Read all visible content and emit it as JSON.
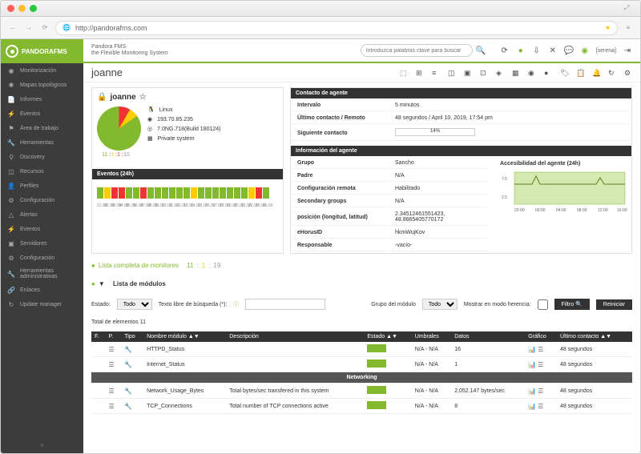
{
  "browser": {
    "url": "http://pandorafms.com"
  },
  "brand": {
    "name": "PANDORAFMS",
    "title": "Pandora FMS",
    "subtitle": "the Flexible Monitoring System"
  },
  "search": {
    "placeholder": "Introduzca palabras clave para buscar"
  },
  "user": {
    "name": "[serena]"
  },
  "sidebar": {
    "items": [
      {
        "icon": "◉",
        "label": "Monitorización"
      },
      {
        "icon": "✱",
        "label": "Mapas topológicos"
      },
      {
        "icon": "📄",
        "label": "Informes"
      },
      {
        "icon": "⚡",
        "label": "Eventos"
      },
      {
        "icon": "⚑",
        "label": "Área de trabajo"
      },
      {
        "icon": "🔧",
        "label": "Herramientas"
      },
      {
        "icon": "⚲",
        "label": "Discovery"
      },
      {
        "icon": "◫",
        "label": "Recursos"
      },
      {
        "icon": "👤",
        "label": "Perfiles"
      },
      {
        "icon": "⚙",
        "label": "Configuración"
      },
      {
        "icon": "△",
        "label": "Alertas"
      },
      {
        "icon": "⚡",
        "label": "Eventos"
      },
      {
        "icon": "▣",
        "label": "Servidores"
      },
      {
        "icon": "⚙",
        "label": "Configuración"
      },
      {
        "icon": "🔧",
        "label": "Herramientas administrativas"
      },
      {
        "icon": "🔗",
        "label": "Enlaces"
      },
      {
        "icon": "↻",
        "label": "Update manager"
      }
    ]
  },
  "page_title": "joanne",
  "agent": {
    "name": "joanne",
    "os": "Linux",
    "ip": "193.70.85.235",
    "version": "7.0NG.718(Build 180124)",
    "system": "Private system",
    "status_counts": "11 : 1 : 1 : 10"
  },
  "contact": {
    "title": "Contacto de agente",
    "rows": [
      {
        "k": "Intervalo",
        "v": "5 minutos"
      },
      {
        "k": "Último contacto / Remoto",
        "v": "48 segundos / April 10, 2019, 17:54 pm"
      },
      {
        "k": "Siguiente contacto",
        "v": "14%"
      }
    ]
  },
  "info": {
    "title": "Información del agente",
    "rows": [
      {
        "k": "Grupo",
        "v": "Sancho"
      },
      {
        "k": "Padre",
        "v": "N/A"
      },
      {
        "k": "Configuración remota",
        "v": "Habilitado"
      },
      {
        "k": "Secondary groups",
        "v": "N/A"
      },
      {
        "k": "posición (longitud, latitud)",
        "v": "2.34512461551423, 48.8665405770172"
      },
      {
        "k": "eHorusID",
        "v": "hkmWujKov"
      },
      {
        "k": "Responsable",
        "v": "-vacío-"
      }
    ]
  },
  "access": {
    "title": "Accesibilidad del agente (24h)",
    "ylabels": [
      "7.5",
      "2.5"
    ],
    "xlabels": [
      "20:00",
      "00:00",
      "04:00",
      "08:00",
      "12:00",
      "16:00"
    ]
  },
  "events": {
    "title": "Eventos (24h)",
    "bars": [
      "g",
      "y",
      "r",
      "r",
      "g",
      "g",
      "r",
      "g",
      "g",
      "g",
      "g",
      "g",
      "g",
      "y",
      "g",
      "g",
      "g",
      "g",
      "g",
      "g",
      "g",
      "y",
      "r",
      "g"
    ],
    "axis": [
      "01.00",
      "02.00",
      "03.00",
      "04.00",
      "05.00",
      "06.00",
      "07.00",
      "08.00",
      "09.00",
      "10.00",
      "11.00",
      "12.00",
      "13.00",
      "14.00",
      "15.00",
      "16.00",
      "17.00",
      "18.00",
      "19.00",
      "20.00",
      "21.00",
      "22.00",
      "23.00",
      "01.00"
    ]
  },
  "monitors": {
    "title": "Lista completa de monitores",
    "counts": "11 : 1 : 19"
  },
  "modules": {
    "title": "Lista de módulos",
    "filter": {
      "estado_label": "Estado:",
      "estado_value": "Todo",
      "search_label": "Texto libre de búsqueda (*):",
      "grupo_label": "Grupo del módulo",
      "grupo_value": "Todo",
      "herencia_label": "Mostrar en modo herencia:",
      "filtro_btn": "Filtro",
      "reset_btn": "Reiniciar"
    },
    "total_label": "Total de elementos 11",
    "cols": {
      "f": "F.",
      "p": "P.",
      "tipo": "Tipo",
      "nombre": "Nombre módulo",
      "desc": "Descripción",
      "estado": "Estado",
      "umbrales": "Umbrales",
      "datos": "Datos",
      "grafico": "Gráfico",
      "contacto": "Último contacto"
    },
    "rows": [
      {
        "nombre": "HTTPD_Status",
        "desc": "",
        "umbrales": "N/A - N/A",
        "datos": "16",
        "contacto": "48 segundos"
      },
      {
        "nombre": "Internet_Status",
        "desc": "",
        "umbrales": "N/A - N/A",
        "datos": "1",
        "contacto": "48 segundos"
      }
    ],
    "section": "Networking",
    "rows2": [
      {
        "nombre": "Network_Usage_Bytes",
        "desc": "Total bytes/sec transfered in this system",
        "umbrales": "N/A - N/A",
        "datos": "2,052.147 bytes/sec",
        "contacto": "48 segundos"
      },
      {
        "nombre": "TCP_Connections",
        "desc": "Total number of TCP connections active",
        "umbrales": "N/A - N/A",
        "datos": "8",
        "contacto": "48 segundos"
      }
    ]
  }
}
